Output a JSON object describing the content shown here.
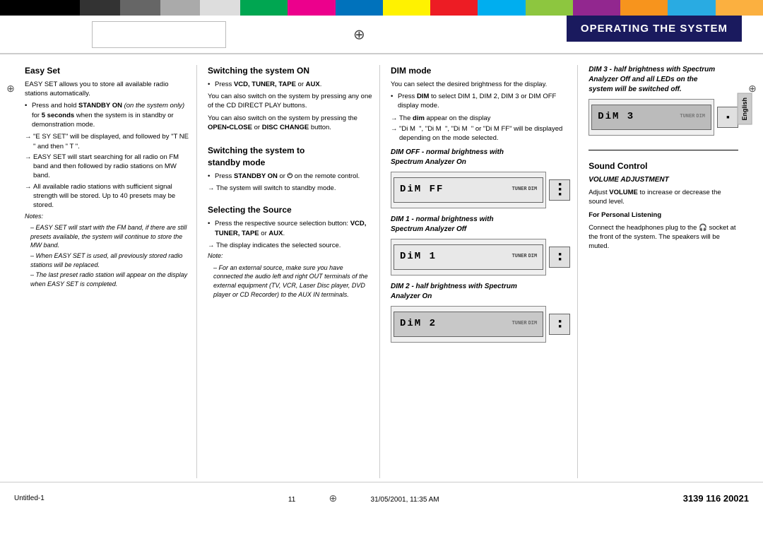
{
  "page": {
    "title": "OPERATING THE SYSTEM",
    "page_number": "11",
    "footer_left": "Untitled-1",
    "footer_center_page": "11",
    "footer_date": "31/05/2001, 11:35 AM",
    "footer_right": "3139 116 20021"
  },
  "sections": {
    "easy_set": {
      "title": "Easy Set",
      "intro": "EASY SET allows you to store all available radio stations automatically.",
      "bullet1_bold": "Press and hold STANDBY ON",
      "bullet1_text": " (on the system only) for ",
      "bullet1_bold2": "5 seconds",
      "bullet1_text2": " when the system is in standby or demonstration mode.",
      "arrow1": "\"E SY SET\" will be displayed, and followed by \"T NE \" and then \" T \".",
      "arrow2": "EASY SET will start searching for all radio on FM band and then followed by radio stations on MW band.",
      "arrow3": "All available radio stations with sufficient signal strength will be stored. Up to 40 presets may be stored.",
      "notes_title": "Notes:",
      "note1": "EASY SET will start with the FM band, if there are still presets available, the system will continue to store the MW band.",
      "note2": "When EASY SET is used, all previously stored radio stations will be replaced.",
      "note3": "The last preset radio station will appear on the display when EASY SET is completed."
    },
    "switching_on": {
      "title": "Switching the system ON",
      "bullet1": "Press VCD, TUNER, TAPE or AUX.",
      "text1": "You can also switch on the system by pressing any one of the CD DIRECT PLAY buttons.",
      "text2": "You can also switch on the system by pressing the OPEN•CLOSE or DISC CHANGE button."
    },
    "switching_standby": {
      "title": "Switching the system to",
      "title2": "standby mode",
      "bullet1": "Press STANDBY ON or the power button on the remote control.",
      "arrow1": "The system will switch to standby mode."
    },
    "selecting_source": {
      "title": "Selecting the Source",
      "text1": "Press the respective source selection button: VCD, TUNER, TAPE or AUX.",
      "arrow1": "The display indicates the selected source.",
      "note_title": "Note:",
      "note1": "For an external source, make sure you have connected the audio left and right OUT terminals of the external equipment (TV, VCR, Laser Disc player, DVD player or CD Recorder) to the AUX IN terminals."
    },
    "dim_mode": {
      "title": "DIM mode",
      "text1": "You can select the desired brightness for the display.",
      "bullet1_bold": "Press DIM",
      "bullet1_text": " to select DIM 1, DIM 2, DIM 3 or DIM OFF display mode.",
      "arrow1": "The DIM appear on the display",
      "arrow2": "\"Di M \", \"Di M \", \"Di M \" or \"Di M FF\" will be displayed depending on the mode selected.",
      "dim_off_title": "DIM OFF - normal brightness with",
      "dim_off_subtitle": "Spectrum Analyzer On",
      "dim_1_title": "DIM 1 - normal brightness with",
      "dim_1_subtitle": "Spectrum Analyzer Off",
      "dim_2_title": "DIM 2 - half brightness with Spectrum",
      "dim_2_subtitle": "Analyzer On"
    },
    "sound_control": {
      "title": "Sound Control",
      "subtitle": "VOLUME ADJUSTMENT",
      "dim3_title": "DIM 3 - half brightness with Spectrum Analyzer Off and all LEDs on the",
      "dim3_subtitle": "system will be switched off.",
      "text1": "Adjust ",
      "text1_bold": "VOLUME",
      "text1_cont": " to increase or decrease the sound level.",
      "personal_title": "For Personal Listening",
      "personal_text": "Connect the headphones plug to the headphone socket at the front of the system. The speakers will be muted."
    }
  },
  "displays": {
    "dim3": "DiM 3",
    "dim_off": "DiM FF",
    "dim1": "DiM 1",
    "dim2": "DiM 2"
  }
}
